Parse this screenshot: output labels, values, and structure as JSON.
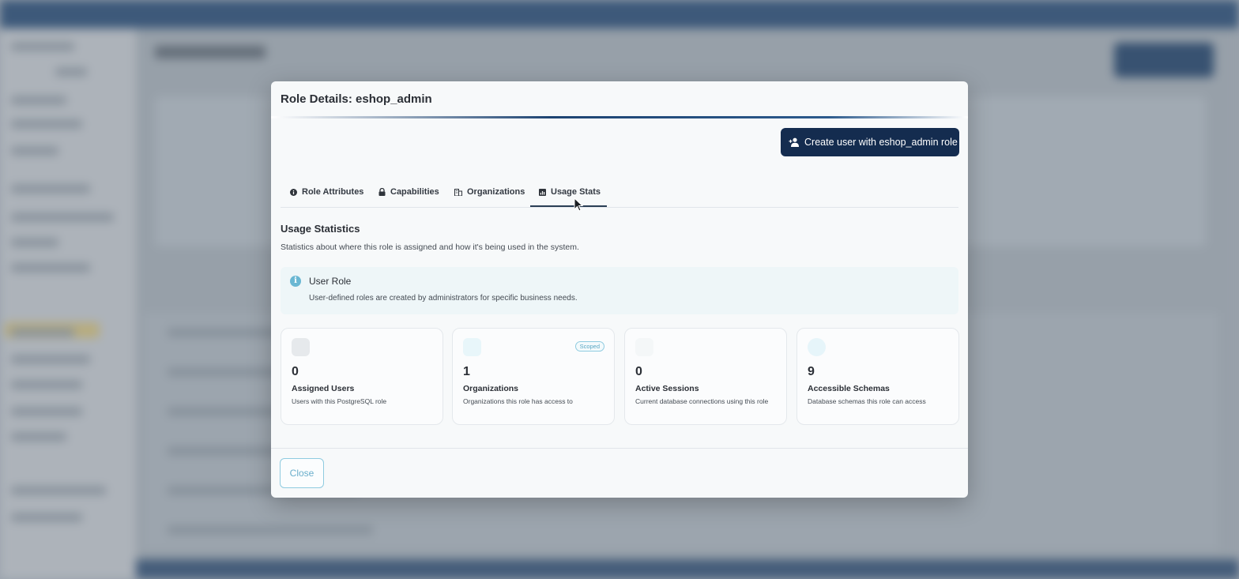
{
  "modal": {
    "title": "Role Details: eshop_admin",
    "create_button_label": "Create user with eshop_admin role",
    "close_label": "Close"
  },
  "tabs": [
    {
      "label": "Role Attributes",
      "icon": "info-circle-icon"
    },
    {
      "label": "Capabilities",
      "icon": "lock-icon"
    },
    {
      "label": "Organizations",
      "icon": "building-icon"
    },
    {
      "label": "Usage Stats",
      "icon": "chart-icon",
      "active": true
    }
  ],
  "usage": {
    "title": "Usage Statistics",
    "description": "Statistics about where this role is assigned and how it's being used in the system."
  },
  "info": {
    "title": "User Role",
    "description": "User-defined roles are created by administrators for specific business needs."
  },
  "stats": [
    {
      "value": "0",
      "label": "Assigned Users",
      "description": "Users with this PostgreSQL role",
      "icon_color": "#e6e9ec"
    },
    {
      "value": "1",
      "label": "Organizations",
      "description": "Organizations this role has access to",
      "badge": "Scoped",
      "icon_color": "#e8f6fa"
    },
    {
      "value": "0",
      "label": "Active Sessions",
      "description": "Current database connections using this role",
      "icon_color": "#f4f7f8"
    },
    {
      "value": "9",
      "label": "Accessible Schemas",
      "description": "Database schemas this role can access",
      "icon_color": "#e6f5fa"
    }
  ],
  "colors": {
    "primary_button": "#142c4f",
    "accent": "#6ab7d3"
  }
}
